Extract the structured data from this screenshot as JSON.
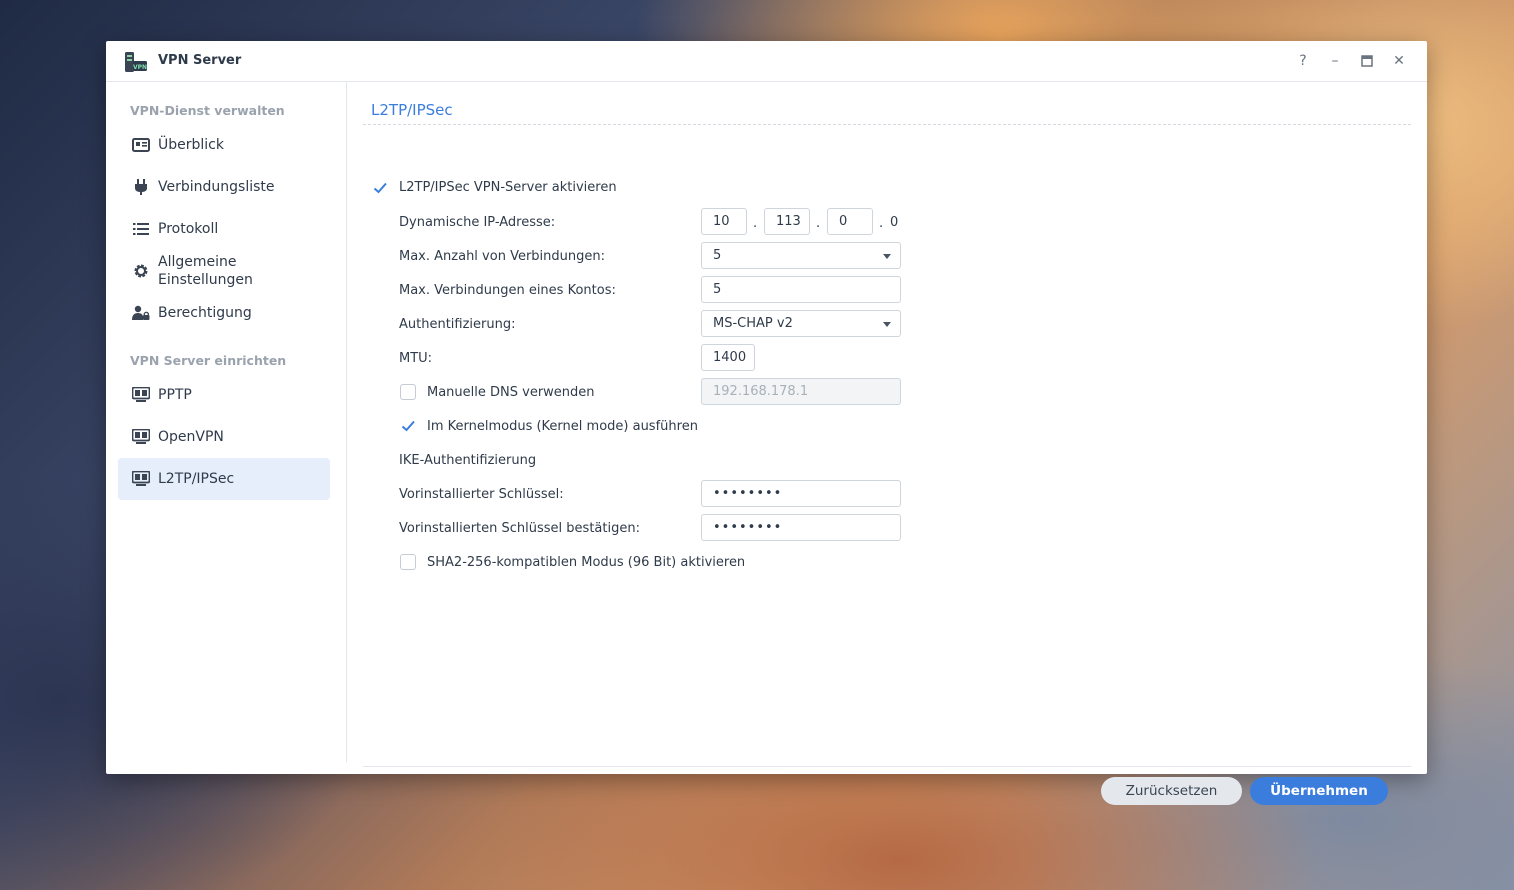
{
  "window": {
    "title": "VPN Server",
    "controls": [
      "?",
      "–",
      "□",
      "✕"
    ]
  },
  "sidebar": {
    "section1": "VPN-Dienst verwalten",
    "section2": "VPN Server einrichten",
    "items": [
      {
        "label": "Überblick",
        "icon": "overview-icon"
      },
      {
        "label": "Verbindungsliste",
        "icon": "plug-icon"
      },
      {
        "label": "Protokoll",
        "icon": "list-icon"
      },
      {
        "label": "Allgemeine Einstellungen",
        "icon": "gear-icon"
      },
      {
        "label": "Berechtigung",
        "icon": "user-lock-icon"
      },
      {
        "label": "PPTP",
        "icon": "server-icon"
      },
      {
        "label": "OpenVPN",
        "icon": "server-icon"
      },
      {
        "label": "L2TP/IPSec",
        "icon": "server-icon",
        "active": true
      }
    ]
  },
  "content": {
    "title": "L2TP/IPSec",
    "enable_label": "L2TP/IPSec VPN-Server aktivieren",
    "enable_checked": true,
    "fields": {
      "dynamic_ip_label": "Dynamische IP-Adresse:",
      "ip_octets": [
        "10",
        "113",
        "0",
        "0"
      ],
      "max_conn_label": "Max. Anzahl von Verbindungen:",
      "max_conn_value": "5",
      "max_conn_account_label": "Max. Verbindungen eines Kontos:",
      "max_conn_account_value": "5",
      "auth_label": "Authentifizierung:",
      "auth_value": "MS-CHAP v2",
      "mtu_label": "MTU:",
      "mtu_value": "1400",
      "manual_dns_label": "Manuelle DNS verwenden",
      "manual_dns_checked": false,
      "manual_dns_value": "192.168.178.1",
      "kernel_mode_label": "Im Kernelmodus (Kernel mode) ausführen",
      "kernel_mode_checked": true,
      "ike_heading": "IKE-Authentifizierung",
      "psk_label": "Vorinstallierter Schlüssel:",
      "psk_value": "••••••••",
      "psk_confirm_label": "Vorinstallierten Schlüssel bestätigen:",
      "psk_confirm_value": "••••••••",
      "sha2_label": "SHA2-256-kompatiblen Modus (96 Bit) aktivieren",
      "sha2_checked": false
    },
    "buttons": {
      "reset": "Zurücksetzen",
      "apply": "Übernehmen"
    }
  },
  "colors": {
    "accent": "#3b7ddd",
    "active_bg": "#e6eefb",
    "text": "#2f3b4a",
    "muted": "#9aa3ad"
  }
}
